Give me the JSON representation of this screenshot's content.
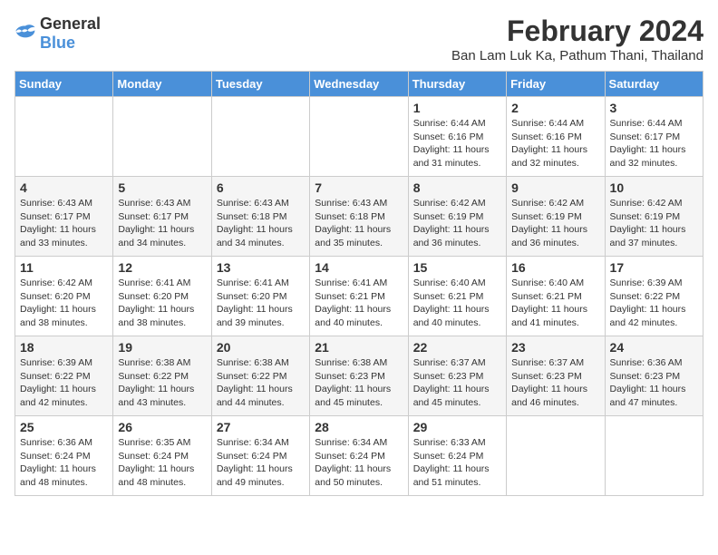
{
  "header": {
    "logo_general": "General",
    "logo_blue": "Blue",
    "title": "February 2024",
    "subtitle": "Ban Lam Luk Ka, Pathum Thani, Thailand"
  },
  "days_of_week": [
    "Sunday",
    "Monday",
    "Tuesday",
    "Wednesday",
    "Thursday",
    "Friday",
    "Saturday"
  ],
  "weeks": [
    [
      {
        "day": "",
        "info": ""
      },
      {
        "day": "",
        "info": ""
      },
      {
        "day": "",
        "info": ""
      },
      {
        "day": "",
        "info": ""
      },
      {
        "day": "1",
        "info": "Sunrise: 6:44 AM\nSunset: 6:16 PM\nDaylight: 11 hours and 31 minutes."
      },
      {
        "day": "2",
        "info": "Sunrise: 6:44 AM\nSunset: 6:16 PM\nDaylight: 11 hours and 32 minutes."
      },
      {
        "day": "3",
        "info": "Sunrise: 6:44 AM\nSunset: 6:17 PM\nDaylight: 11 hours and 32 minutes."
      }
    ],
    [
      {
        "day": "4",
        "info": "Sunrise: 6:43 AM\nSunset: 6:17 PM\nDaylight: 11 hours and 33 minutes."
      },
      {
        "day": "5",
        "info": "Sunrise: 6:43 AM\nSunset: 6:17 PM\nDaylight: 11 hours and 34 minutes."
      },
      {
        "day": "6",
        "info": "Sunrise: 6:43 AM\nSunset: 6:18 PM\nDaylight: 11 hours and 34 minutes."
      },
      {
        "day": "7",
        "info": "Sunrise: 6:43 AM\nSunset: 6:18 PM\nDaylight: 11 hours and 35 minutes."
      },
      {
        "day": "8",
        "info": "Sunrise: 6:42 AM\nSunset: 6:19 PM\nDaylight: 11 hours and 36 minutes."
      },
      {
        "day": "9",
        "info": "Sunrise: 6:42 AM\nSunset: 6:19 PM\nDaylight: 11 hours and 36 minutes."
      },
      {
        "day": "10",
        "info": "Sunrise: 6:42 AM\nSunset: 6:19 PM\nDaylight: 11 hours and 37 minutes."
      }
    ],
    [
      {
        "day": "11",
        "info": "Sunrise: 6:42 AM\nSunset: 6:20 PM\nDaylight: 11 hours and 38 minutes."
      },
      {
        "day": "12",
        "info": "Sunrise: 6:41 AM\nSunset: 6:20 PM\nDaylight: 11 hours and 38 minutes."
      },
      {
        "day": "13",
        "info": "Sunrise: 6:41 AM\nSunset: 6:20 PM\nDaylight: 11 hours and 39 minutes."
      },
      {
        "day": "14",
        "info": "Sunrise: 6:41 AM\nSunset: 6:21 PM\nDaylight: 11 hours and 40 minutes."
      },
      {
        "day": "15",
        "info": "Sunrise: 6:40 AM\nSunset: 6:21 PM\nDaylight: 11 hours and 40 minutes."
      },
      {
        "day": "16",
        "info": "Sunrise: 6:40 AM\nSunset: 6:21 PM\nDaylight: 11 hours and 41 minutes."
      },
      {
        "day": "17",
        "info": "Sunrise: 6:39 AM\nSunset: 6:22 PM\nDaylight: 11 hours and 42 minutes."
      }
    ],
    [
      {
        "day": "18",
        "info": "Sunrise: 6:39 AM\nSunset: 6:22 PM\nDaylight: 11 hours and 42 minutes."
      },
      {
        "day": "19",
        "info": "Sunrise: 6:38 AM\nSunset: 6:22 PM\nDaylight: 11 hours and 43 minutes."
      },
      {
        "day": "20",
        "info": "Sunrise: 6:38 AM\nSunset: 6:22 PM\nDaylight: 11 hours and 44 minutes."
      },
      {
        "day": "21",
        "info": "Sunrise: 6:38 AM\nSunset: 6:23 PM\nDaylight: 11 hours and 45 minutes."
      },
      {
        "day": "22",
        "info": "Sunrise: 6:37 AM\nSunset: 6:23 PM\nDaylight: 11 hours and 45 minutes."
      },
      {
        "day": "23",
        "info": "Sunrise: 6:37 AM\nSunset: 6:23 PM\nDaylight: 11 hours and 46 minutes."
      },
      {
        "day": "24",
        "info": "Sunrise: 6:36 AM\nSunset: 6:23 PM\nDaylight: 11 hours and 47 minutes."
      }
    ],
    [
      {
        "day": "25",
        "info": "Sunrise: 6:36 AM\nSunset: 6:24 PM\nDaylight: 11 hours and 48 minutes."
      },
      {
        "day": "26",
        "info": "Sunrise: 6:35 AM\nSunset: 6:24 PM\nDaylight: 11 hours and 48 minutes."
      },
      {
        "day": "27",
        "info": "Sunrise: 6:34 AM\nSunset: 6:24 PM\nDaylight: 11 hours and 49 minutes."
      },
      {
        "day": "28",
        "info": "Sunrise: 6:34 AM\nSunset: 6:24 PM\nDaylight: 11 hours and 50 minutes."
      },
      {
        "day": "29",
        "info": "Sunrise: 6:33 AM\nSunset: 6:24 PM\nDaylight: 11 hours and 51 minutes."
      },
      {
        "day": "",
        "info": ""
      },
      {
        "day": "",
        "info": ""
      }
    ]
  ],
  "colors": {
    "header_bg": "#4a90d9",
    "header_text": "#ffffff",
    "border": "#cccccc",
    "row_even": "#f5f5f5",
    "row_odd": "#ffffff"
  }
}
